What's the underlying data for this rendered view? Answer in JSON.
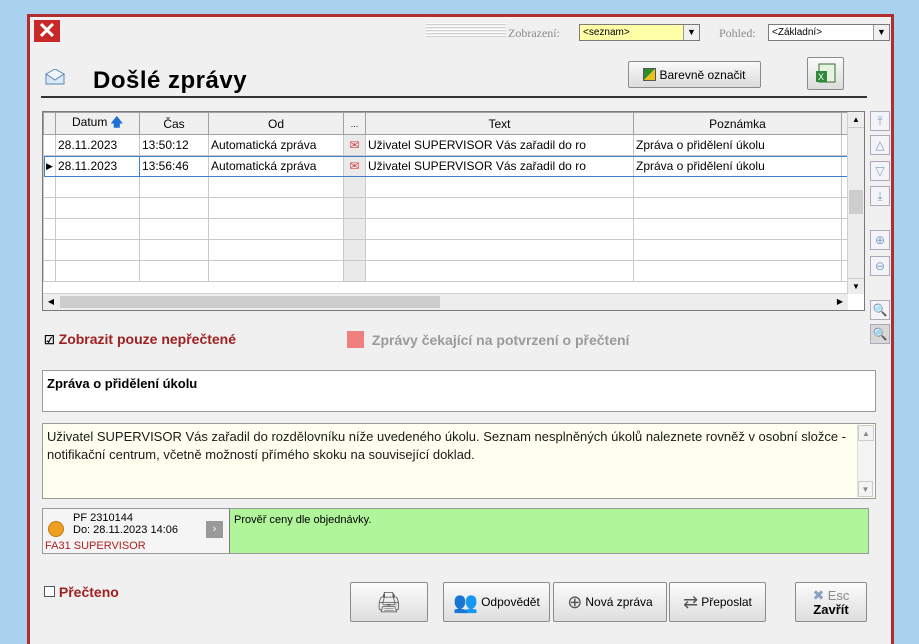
{
  "window": {
    "close_glyph": "✕"
  },
  "toolbar": {
    "view_label": "Zobrazení:",
    "view_value": "<seznam>",
    "perspective_label": "Pohled:",
    "perspective_value": "<Základní>"
  },
  "header": {
    "title": "Došlé zprávy",
    "color_button": "Barevně označit"
  },
  "grid": {
    "columns": [
      "Datum",
      "Čas",
      "Od",
      "...",
      "Text",
      "Poznámka"
    ],
    "rows": [
      {
        "date": "28.11.2023",
        "time": "13:50:12",
        "from": "Automatická zpráva",
        "text": "Uživatel SUPERVISOR Vás zařadil do ro",
        "note": "Zpráva o přidělení úkolu"
      },
      {
        "date": "28.11.2023",
        "time": "13:56:46",
        "from": "Automatická zpráva",
        "text": "Uživatel SUPERVISOR Vás zařadil do ro",
        "note": "Zpráva o přidělení úkolu"
      }
    ]
  },
  "filters": {
    "unread_only": "Zobrazit pouze nepřečtené",
    "awaiting_receipt": "Zprávy čekající na potvrzení o přečtení"
  },
  "message": {
    "subject": "Zpráva o přidělení úkolu",
    "body": "Uživatel SUPERVISOR Vás zařadil do rozdělovníku níže uvedeného úkolu. Seznam nesplněných úkolů naleznete rovněž v osobní složce - notifikační centrum, včetně možností přímého skoku na související doklad."
  },
  "task": {
    "number": "PF 2310144",
    "due": "Do: 28.11.2023 14:06",
    "assignee": "FA31 SUPERVISOR",
    "description": "Prověř ceny dle objednávky."
  },
  "footer": {
    "read_label": "Přečteno",
    "reply": "Odpovědět",
    "new_message": "Nová zpráva",
    "forward": "Přeposlat",
    "close_key": "Esc",
    "close": "Zavřít"
  },
  "colors": {
    "accent_border": "#b32d2d",
    "task_bg": "#b0f59a",
    "body_bg": "#fffff0"
  }
}
